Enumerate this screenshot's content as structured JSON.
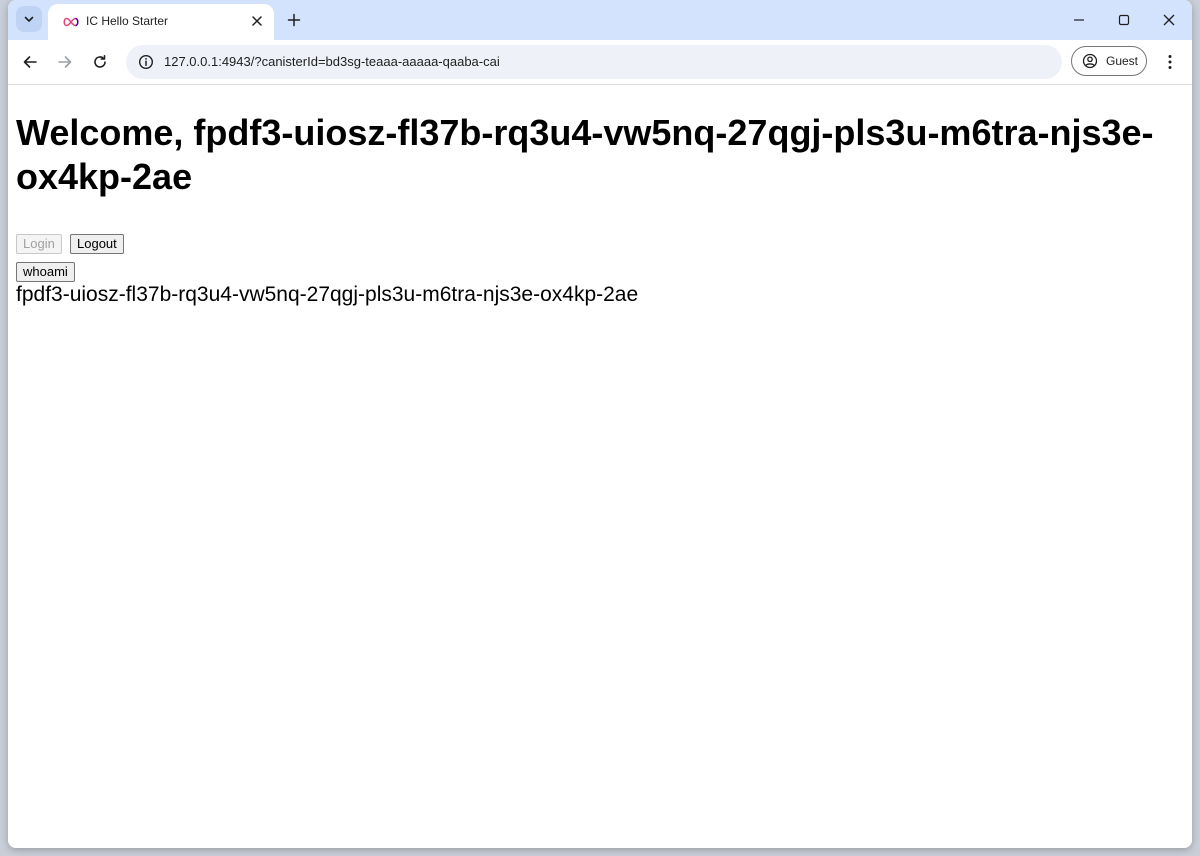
{
  "browser": {
    "tab": {
      "title": "IC Hello Starter"
    },
    "omnibox": {
      "url": "127.0.0.1:4943/?canisterId=bd3sg-teaaa-aaaaa-qaaba-cai"
    },
    "profile": {
      "label": "Guest"
    },
    "icons": {
      "tab_search": "chevron-down-icon",
      "close_tab": "close-icon",
      "new_tab": "plus-icon",
      "back": "arrow-left-icon",
      "forward": "arrow-right-icon",
      "reload": "reload-icon",
      "site_info": "info-icon",
      "profile": "person-icon",
      "menu": "more-vertical-icon",
      "minimize": "minimize-icon",
      "maximize": "maximize-icon",
      "close_window": "close-icon"
    },
    "colors": {
      "tabstrip": "#d3e3fd",
      "omnibox": "#eef2f8"
    }
  },
  "page": {
    "heading": "Welcome, fpdf3-uiosz-fl37b-rq3u4-vw5nq-27qgj-pls3u-m6tra-njs3e-ox4kp-2ae",
    "login_button": "Login",
    "logout_button": "Logout",
    "whoami_button": "whoami",
    "principal_output": "fpdf3-uiosz-fl37b-rq3u4-vw5nq-27qgj-pls3u-m6tra-njs3e-ox4kp-2ae"
  }
}
